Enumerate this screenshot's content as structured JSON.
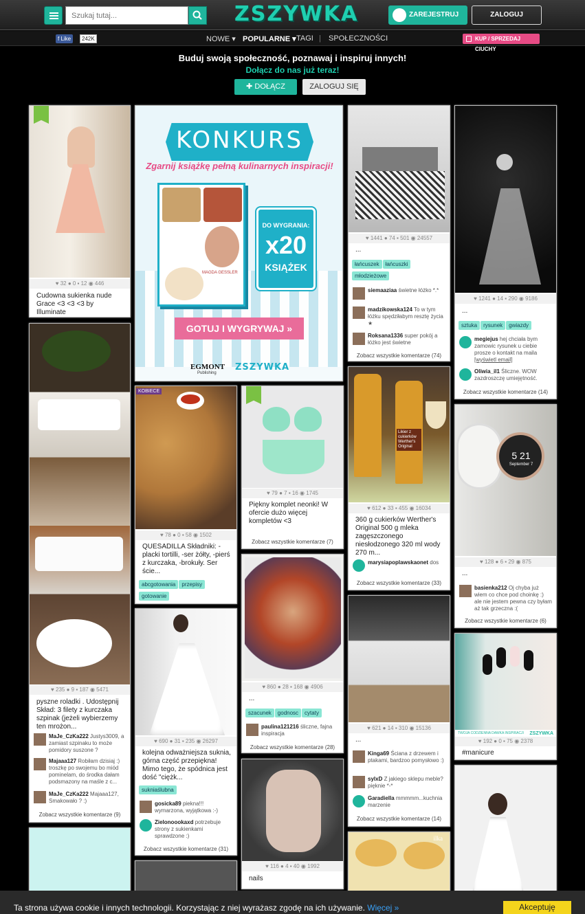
{
  "header": {
    "search_placeholder": "Szukaj tutaj...",
    "logo": "ZSZYWKA",
    "register": "ZAREJESTRUJ SIĘ",
    "login": "ZALOGUJ"
  },
  "subnav": {
    "fb_like": "Like",
    "fb_count": "242K",
    "new": "NOWE",
    "popular": "POPULARNE",
    "tags": "TAGI",
    "community": "SPOŁECZNOŚCI",
    "buy_sell": "KUP / SPRZEDAJ CIUCHY"
  },
  "hero": {
    "headline": "Buduj swoją społeczność, poznawaj i inspiruj innych!",
    "sub": "Dołącz do nas już teraz!",
    "join": "DOŁĄCZ",
    "login": "ZALOGUJ SIĘ"
  },
  "promo": {
    "title": "KONKURS",
    "subtitle": "Zgarnij książkę pełną kulinarnych inspiracji!",
    "win": "DO WYGRANIA:",
    "count": "x20",
    "books": "KSIĄŻEK",
    "cta": "GOTUJ I WYGRYWAJ »",
    "brand1": "EGMONT",
    "brand1_sub": "Publishing",
    "brand2": "ZSZYWKA",
    "cover_author": "MAGDA GESSLER"
  },
  "cards": {
    "c1": {
      "stats": "♥ 32  ● 0  ▪ 12  ◉ 446",
      "desc": "Cudowna sukienka nude Grace <3 <3 <3 by Illuminate"
    },
    "c2": {
      "stats": "♥ 235  ● 9  ▪ 187  ◉ 5471",
      "desc": "pyszne roladki . Udostępnij Skład: 3 filety z kurczaka szpinak (jeżeli wybierzemy ten mrożon...",
      "comments": [
        {
          "user": "MaJe_CzKa222",
          "text": "Justys3009, a zamiast szpinaku to może pomidory suszone ?"
        },
        {
          "user": "Majaaa127",
          "text": "Robiłam dzisiaj :) troszkę po swojemu bo miód pominelam, do środka dałam podsmazony na maśle z c..."
        },
        {
          "user": "MaJe_CzKa222",
          "text": "Majaaa127, Smakowało ? :)"
        }
      ],
      "more": "Zobacz wszystkie komentarze (9)"
    },
    "c3": {
      "stats": "♥ 78  ● 0  ▪ 58  ◉ 1502",
      "desc": "QUESADILLA Składniki: -placki tortilli, -ser żółty, -pierś z kurczaka, -brokuły. Ser ście...",
      "tags": [
        "abcgotowania",
        "przepisy",
        "gotowanie"
      ],
      "label": "KOBIECE"
    },
    "c4": {
      "stats": "♥ 690  ● 31  ▪ 235  ◉ 26297",
      "desc": "kolejna odważniejsza suknia, górna część przepiękna! Mimo tego, że spódnica jest dość \"ciężk...",
      "tags": [
        "sukniaślubna"
      ],
      "comments": [
        {
          "user": "gosicka89",
          "text": "piekna!!! wymarzona, wyjątkowa :-)"
        },
        {
          "user": "Zielonoookaxd",
          "text": "potrzebuje strony z sukienkami sprawdzone :)"
        }
      ],
      "more": "Zobacz wszystkie komentarze (31)"
    },
    "c5": {
      "stats": "♥ 79  ● 7  ▪ 16  ◉ 1745",
      "desc": "Piękny komplet neonki! W ofercie dużo więcej kompletów <3",
      "more": "Zobacz wszystkie komentarze (7)"
    },
    "c6": {
      "stats": "♥ 860  ● 28  ▪ 168  ◉ 4906",
      "desc": "...",
      "tags": [
        "szacunek",
        "godnosc",
        "cytaty"
      ],
      "comments": [
        {
          "user": "paulina121216",
          "text": "śliczne, fajna inspiracja"
        }
      ],
      "more": "Zobacz wszystkie komentarze (28)"
    },
    "c7": {
      "stats": "♥ 116  ● 4  ▪ 40  ◉ 1992",
      "desc": "nails"
    },
    "c8": {
      "stats": "♥ 1441  ● 74  ▪ 501  ◉ 24557",
      "desc": "...",
      "tags": [
        "łańcuszek",
        "łańcuszki",
        "młodzieżowe"
      ],
      "comments": [
        {
          "user": "siemaaziaa",
          "text": "świetne łóżko *.*"
        },
        {
          "user": "madzikowska124",
          "text": "To w tym łóżku spędziłabym resztę życia ★"
        },
        {
          "user": "Roksana1336",
          "text": "super pokój a łóżko jest świetne"
        }
      ],
      "more": "Zobacz wszystkie komentarze (74)"
    },
    "c9": {
      "stats": "♥ 612  ● 33  ▪ 455  ◉ 16034",
      "desc": "360 g cukierków Werther's Original 500 g mleka zagęszczonego niesłodzonego 320 ml wody 270 m...",
      "comments": [
        {
          "user": "marysiapoplawskaonet",
          "text": "dos"
        }
      ],
      "more": "Zobacz wszystkie komentarze (33)",
      "bottle": "Likier z cukierków Werther's Original"
    },
    "c10": {
      "stats": "♥ 621  ● 14  ▪ 310  ◉ 15136",
      "desc": "...",
      "comments": [
        {
          "user": "Kinga69",
          "text": "Ściana z drzewem i ptakami, bardzoo pomysłowo :)"
        },
        {
          "user": "sylxD",
          "text": "Z jakiego sklepu meble? pięknie *-*"
        },
        {
          "user": "Garadiella",
          "text": "mmmmm...kuchnia marzenie"
        }
      ],
      "more": "Zobacz wszystkie komentarze (14)"
    },
    "c11": {
      "label": "ilka"
    },
    "c12": {
      "stats": "♥ 1241  ● 14  ▪ 290  ◉ 9186",
      "desc": "...",
      "tags": [
        "sztuka",
        "rysunek",
        "gwiazdy"
      ],
      "comments": [
        {
          "user": "megiejus",
          "text": "hej chciała bym zamowic rysunek u ciebie prosze o kontakt na maila",
          "link": "[wyświetl email]"
        },
        {
          "user": "Oliwia_il1",
          "text": "Śliczne. WOW zazdroszczę umiejętność."
        }
      ],
      "more": "Zobacz wszystkie komentarze (14)"
    },
    "c13": {
      "stats": "♥ 128  ● 6  ▪ 29  ◉ 875",
      "desc": "...",
      "comments": [
        {
          "user": "basienka212",
          "text": "Oj chyba już wiem co chce pod choinkę :) ale nie jestem pewna czy byłam aż tak grzeczna :("
        }
      ],
      "more": "Zobacz wszystkie komentarze (6)",
      "watch_time": "5 21",
      "watch_date": "September 7"
    },
    "c14": {
      "stats": "♥ 192  ● 0  ▪ 75  ◉ 2378",
      "desc": "#manicure",
      "brand": "ZSZYWKA",
      "caption": "TWOJA CODZIENNA DAWKA INSPIRACJI"
    }
  },
  "cookie": {
    "text": "Ta strona używa cookie i innych technologii. Korzystając z niej wyrażasz zgodę na ich używanie.",
    "more": "Więcej »",
    "accept": "Akceptuję"
  }
}
